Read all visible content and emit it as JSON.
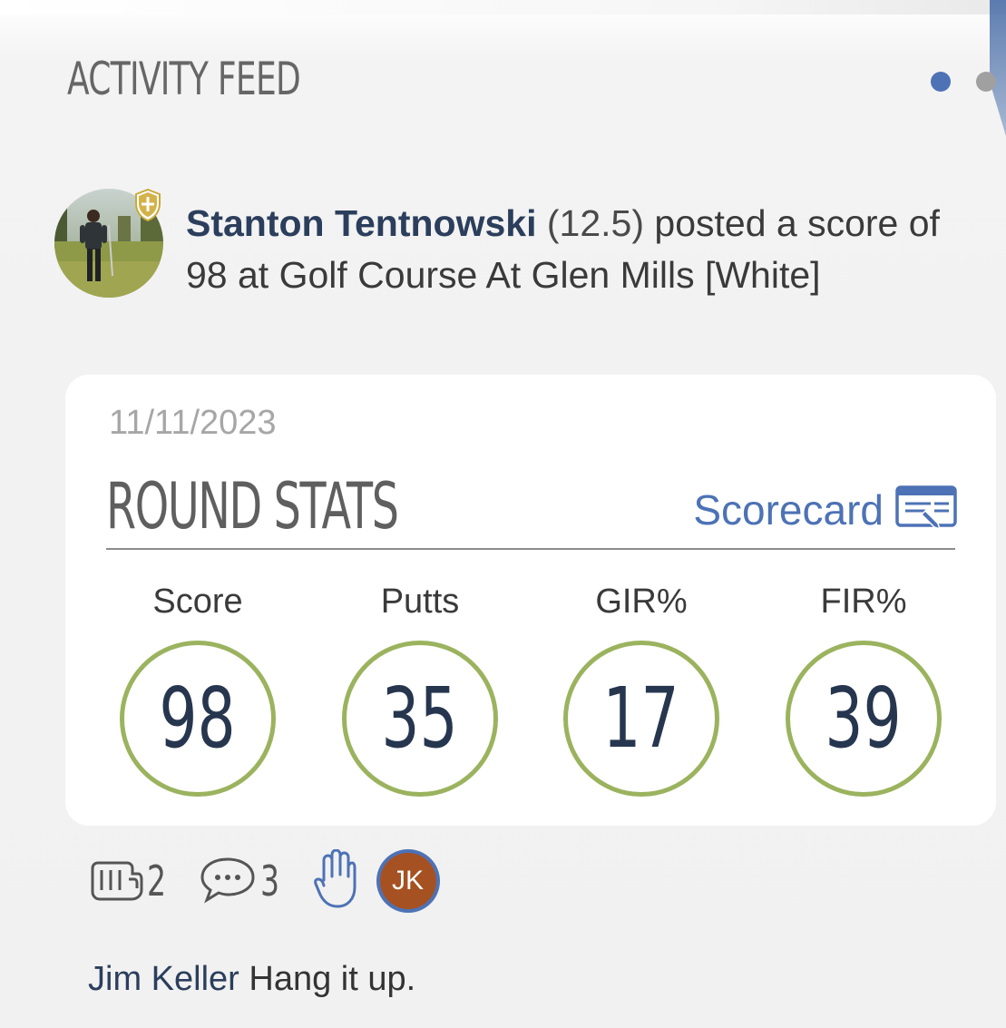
{
  "header": {
    "title": "ACTIVITY FEED",
    "pager": {
      "total_pages": 2,
      "active_index": 0
    }
  },
  "post": {
    "author": "Stanton Tentnowski",
    "handicap": "(12.5)",
    "message": "posted a score of 98 at Golf Course At Glen Mills [White]"
  },
  "round": {
    "date": "11/11/2023",
    "section_title": "ROUND STATS",
    "scorecard_label": "Scorecard",
    "stats": [
      {
        "label": "Score",
        "value": "98"
      },
      {
        "label": "Putts",
        "value": "35"
      },
      {
        "label": "GIR%",
        "value": "17"
      },
      {
        "label": "FIR%",
        "value": "39"
      }
    ]
  },
  "actions": {
    "fist_bump_count": "2",
    "comment_count": "3",
    "reactor_initials": "JK"
  },
  "comment": {
    "author": "Jim Keller",
    "text": "Hang it up."
  },
  "colors": {
    "accent_blue": "#4d72b5",
    "name_navy": "#2b3e5c",
    "ring_green": "#9bb35e",
    "initials_bg": "#a65121"
  },
  "icons": {
    "shield": "shield-plus-icon",
    "scorecard": "scorecard-edit-icon",
    "fist_bump": "fist-bump-icon",
    "comment": "speech-bubble-icon",
    "hand": "raised-hand-icon"
  }
}
